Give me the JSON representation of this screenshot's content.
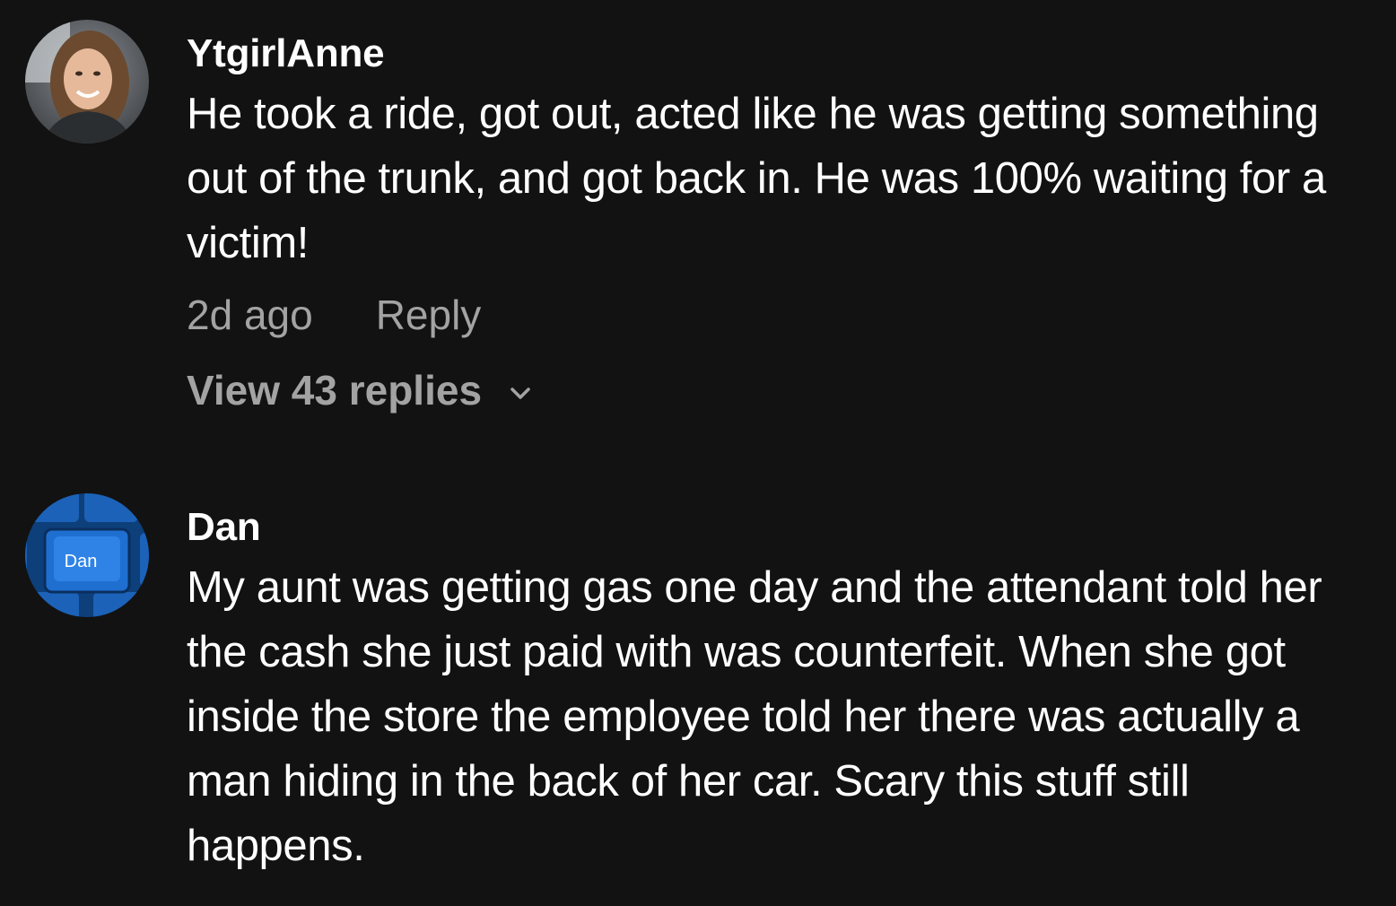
{
  "comments": [
    {
      "username": "YtgirlAnne",
      "text": "He took a ride, got out, acted like he was getting something out of the trunk, and got back in. He was 100% waiting for a victim!",
      "time": "2d ago",
      "reply_label": "Reply",
      "view_replies_label": "View 43 replies",
      "avatar_icon": "avatar-photo-woman"
    },
    {
      "username": "Dan",
      "text": "My aunt was getting gas one day and the attendant told her the cash she just paid with was counterfeit. When she got inside the store the employee told her there was actually a man hiding in the back of her car. Scary this stuff still happens.",
      "avatar_icon": "avatar-keyboard-key",
      "avatar_key_label": "Dan"
    }
  ],
  "colors": {
    "background": "#121212",
    "primary_text": "#ffffff",
    "secondary_text": "#a3a3a3",
    "avatar_blue": "#1f6fd1"
  }
}
